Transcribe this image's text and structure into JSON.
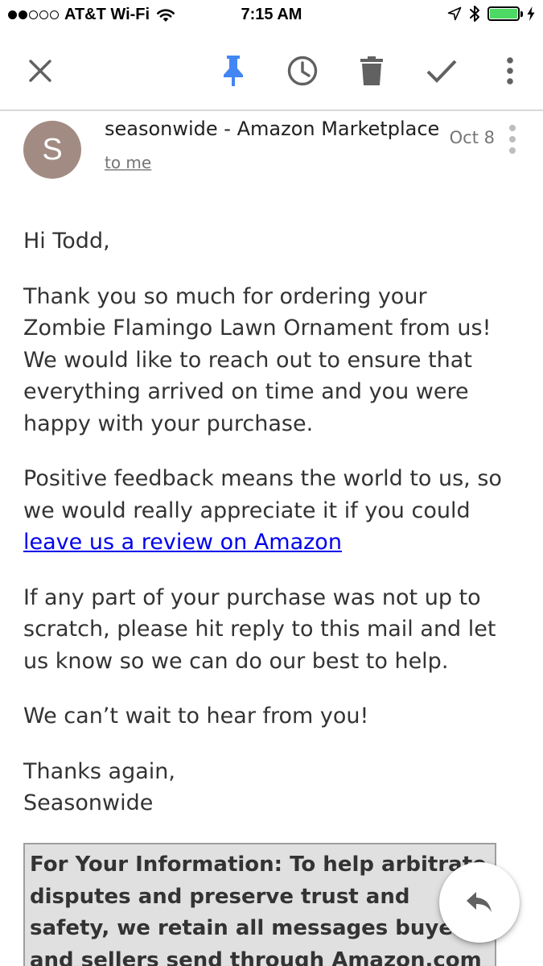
{
  "status_bar": {
    "carrier": "AT&T Wi-Fi",
    "time": "7:15 AM",
    "battery_color": "#4cd964",
    "signal_dots_full": 2,
    "signal_dots_total": 5,
    "icons": [
      "wifi-icon",
      "location-arrow-icon",
      "bluetooth-icon",
      "battery-icon",
      "charging-bolt-icon"
    ]
  },
  "toolbar": {
    "icons": [
      "close-icon",
      "pin-icon",
      "snooze-clock-icon",
      "trash-icon",
      "done-check-icon",
      "more-vert-icon"
    ],
    "pin_color": "#4285f4"
  },
  "email": {
    "avatar_initial": "S",
    "avatar_color": "#a28b83",
    "sender": "seasonwide - Amazon Marketplace",
    "recipient": "to me",
    "date": "Oct 8",
    "greeting": "Hi Todd,",
    "paragraph1": "Thank you so much for ordering your Zombie Flamingo Lawn Ornament from us! We would like to reach out to ensure that everything arrived on time and you were happy with your purchase.",
    "paragraph2_text": "Positive feedback means the world to us, so we would really appreciate it if you could",
    "review_link": "leave us a review on Amazon",
    "paragraph3": "If any part of your purchase was not up to scratch, please hit reply to this mail and let us know so we can do our best to help.",
    "paragraph4": "We can’t wait to hear from you!",
    "sign_off": "Thanks again,",
    "signature": "Seasonwide",
    "info_box": "For Your Information: To help arbitrate disputes and preserve trust and safety, we retain all messages buyers and sellers send through Amazon.com for two years. This"
  },
  "fab": {
    "icon": "reply-icon"
  }
}
